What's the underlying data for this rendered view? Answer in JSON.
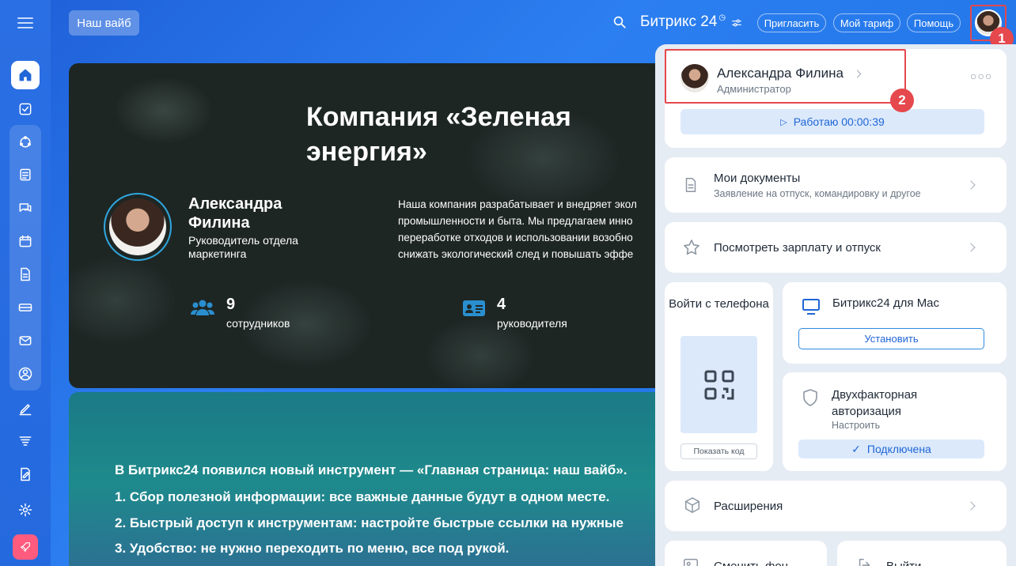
{
  "topbar": {
    "vibe_button": "Наш вайб",
    "brand": "Битрикс 24",
    "invite": "Пригласить",
    "plan": "Мой тариф",
    "help": "Помощь"
  },
  "badges": {
    "one": "1",
    "two": "2"
  },
  "hero": {
    "title": "Компания «Зеленая энергия»",
    "person_name": "Александра Филина",
    "person_role": "Руководитель отдела маркетинга",
    "description": [
      "Наша компания разрабатывает и внедряет экол",
      "промышленности и быта. Мы предлагаем инно",
      "переработке отходов и использовании возобно",
      "снижать экологический след и повышать эффе"
    ],
    "stat_employees_num": "9",
    "stat_employees_label": "сотрудников",
    "stat_managers_num": "4",
    "stat_managers_label": "руководителя"
  },
  "promo": {
    "lines": [
      "В Битрикс24 появился новый инструмент — «Главная страница: наш вайб».",
      "1. Сбор полезной информации: все важные данные будут в одном месте.",
      "2. Быстрый доступ к инструментам: настройте быстрые ссылки на нужные",
      "3. Удобство: не нужно переходить по меню, все под рукой."
    ]
  },
  "panel": {
    "profile_name": "Александра Филина",
    "profile_role": "Администратор",
    "work_button": "Работаю 00:00:39",
    "docs_title": "Мои документы",
    "docs_sub": "Заявление на отпуск, командировку и другое",
    "salary_title": "Посмотреть зарплату и отпуск",
    "phone_title": "Войти с телефона",
    "show_code": "Показать код",
    "mac_title": "Битрикс24 для Mac",
    "install": "Установить",
    "twofa_title": "Двухфакторная авторизация",
    "twofa_sub": "Настроить",
    "connected": "Подключена",
    "extensions": "Расширения",
    "change_bg": "Сменить фон",
    "logout": "Выйти"
  },
  "colors": {
    "accent": "#2066d6",
    "badge": "#e5484d"
  }
}
